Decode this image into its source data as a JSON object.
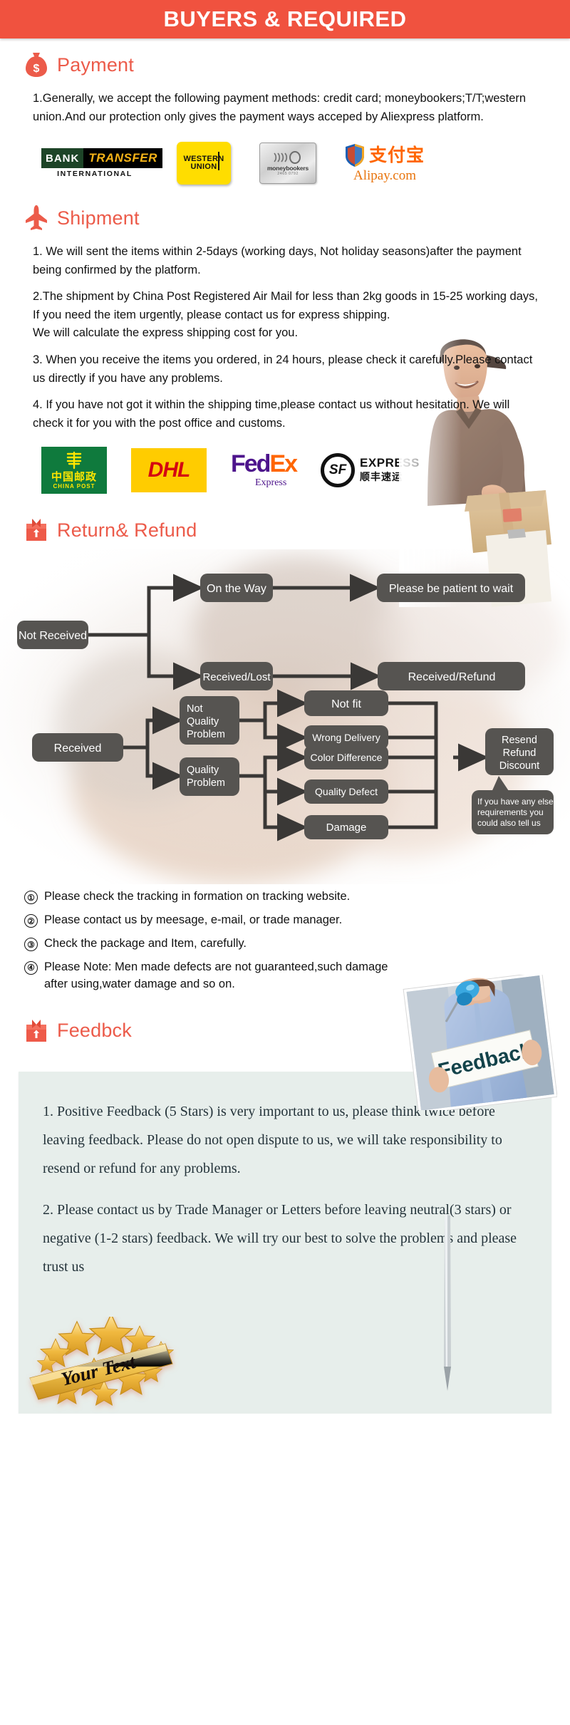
{
  "banner": {
    "title": "BUYERS & REQUIRED",
    "bg_color": "#f0523f",
    "text_color": "#ffffff"
  },
  "accent_color": "#ec5b4a",
  "sections": {
    "payment": {
      "icon": "money-bag-icon",
      "heading": "Payment",
      "paragraphs": [
        "1.Generally, we accept the following payment methods: credit card; moneybookers;T/T;western union.And our protection only gives the payment ways acceped by Aliexpress platform."
      ],
      "logos": [
        {
          "name": "bank-transfer-logo",
          "line1": "BANK",
          "line2": "TRANSFER",
          "line3": "INTERNATIONAL"
        },
        {
          "name": "western-union-logo",
          "line1": "WESTERN",
          "line2": "UNION"
        },
        {
          "name": "moneybookers-logo",
          "line1": "moneybookers",
          "line2": "2465 0792"
        },
        {
          "name": "alipay-logo",
          "line1": "支付宝",
          "line2": "Alipay.com"
        }
      ]
    },
    "shipment": {
      "icon": "airplane-icon",
      "heading": "Shipment",
      "paragraphs": [
        "1. We will sent the items within 2-5days (working days, Not holiday seasons)after the payment being confirmed by the platform.",
        "2.The shipment by China Post Registered Air Mail for less than  2kg goods in 15-25 working days, If  you need the item urgently, please contact us for express shipping.\nWe will calculate the express shipping cost for you.",
        "3. When you receive the items you ordered, in 24 hours, please check it carefully.Please contact us directly if you have any problems.",
        "4. If you have not got it within the shipping time,please contact us without hesitation. We will check it for you with the post office and customs."
      ],
      "carriers": [
        {
          "name": "china-post-logo",
          "cn": "中国邮政",
          "en": "CHINA POST"
        },
        {
          "name": "dhl-logo",
          "text": "DHL"
        },
        {
          "name": "fedex-logo",
          "part1": "Fed",
          "part2": "Ex",
          "sub": "Express"
        },
        {
          "name": "sf-express-logo",
          "mark": "SF",
          "en": "EXPRESS",
          "cn": "顺丰速运"
        }
      ]
    },
    "return_refund": {
      "icon": "return-box-icon",
      "heading": "Return& Refund",
      "flowchart": {
        "nodes": [
          {
            "id": "not-received",
            "label": "Not Received"
          },
          {
            "id": "on-the-way",
            "label": "On the Way"
          },
          {
            "id": "please-be-patient",
            "label": "Please be patient to wait"
          },
          {
            "id": "received-lost",
            "label": "Received/Lost"
          },
          {
            "id": "received-refund",
            "label": "Received/Refund"
          },
          {
            "id": "received",
            "label": "Received"
          },
          {
            "id": "not-quality-problem",
            "label": "Not\nQuality\nProblem"
          },
          {
            "id": "quality-problem",
            "label": "Quality\nProblem"
          },
          {
            "id": "not-fit",
            "label": "Not fit"
          },
          {
            "id": "wrong-delivery",
            "label": "Wrong Delivery"
          },
          {
            "id": "color-difference",
            "label": "Color Difference"
          },
          {
            "id": "quality-defect",
            "label": "Quality Defect"
          },
          {
            "id": "damage",
            "label": "Damage"
          },
          {
            "id": "resend-refund-discount",
            "label": "Resend\nRefund\nDiscount"
          },
          {
            "id": "any-else-requirements",
            "label": "If you have any else\nrequirements you\ncould also tell us"
          }
        ],
        "node_bg": "#565451",
        "edge_color": "#3a3836"
      },
      "notes": [
        {
          "marker": "①",
          "text": "Please check the tracking in formation on tracking website."
        },
        {
          "marker": "②",
          "text": "Please contact us by meesage, e-mail, or trade manager."
        },
        {
          "marker": "③",
          "text": "Check the package and Item, carefully."
        },
        {
          "marker": "④",
          "text": "Please Note: Men made defects  are not guaranteed,such damage\n    after using,water damage and so on."
        }
      ]
    },
    "feedback": {
      "icon": "return-box-icon",
      "heading": "Feedbck",
      "photo_sign_text": "Feedback",
      "card_bg": "#e7eeeb",
      "paragraphs": [
        "1. Positive Feedback (5 Stars) is very important to us, please think twice before leaving feedback. Please do not open dispute to us,   we will take responsibility to resend or refund for any problems.",
        "2. Please contact us by Trade Manager or Letters before leaving neutral(3 stars) or negative (1-2 stars) feedback. We will try our best to solve the problems and please trust us"
      ],
      "badge_text": "Your Text"
    }
  }
}
